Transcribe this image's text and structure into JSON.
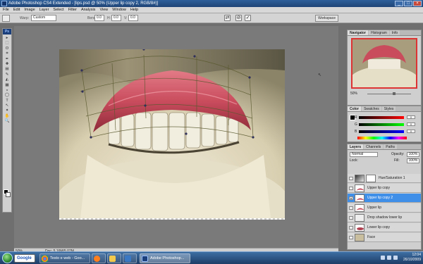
{
  "titlebar": {
    "title": "Adobe Photoshop CS4 Extended - [lips.psd @ 50% (Upper lip copy 2, RGB/8#)]",
    "min": "_",
    "max": "□",
    "close": "×"
  },
  "menu": [
    "File",
    "Edit",
    "Image",
    "Layer",
    "Select",
    "Filter",
    "Analysis",
    "View",
    "Window",
    "Help"
  ],
  "options": {
    "warp_label": "Warp:",
    "warp_value": "Custom",
    "bend_label": "Bend:",
    "bend_value": "0.0",
    "h_label": "H:",
    "h_value": "0.0",
    "v_label": "V:",
    "v_value": "0.0",
    "cancel_icon": "⊘",
    "commit_icon": "✓",
    "workspace": "Workspace"
  },
  "toolbox": {
    "logo": "Ps",
    "tools": [
      "▸",
      "⬚",
      "ʘ",
      "⌗",
      "✒",
      "✚",
      "▤",
      "✎",
      "◭",
      "▦",
      "◒",
      "◯",
      "T",
      "↖",
      "✦",
      "✋",
      "🔍"
    ]
  },
  "status": {
    "zoom": "50%",
    "doc": "Doc: 5.16M/5.07M"
  },
  "navigator": {
    "tabs": [
      "Navigator",
      "Histogram",
      "Info"
    ],
    "zoom": "50%"
  },
  "color": {
    "tabs": [
      "Color",
      "Swatches",
      "Styles"
    ],
    "r_label": "R",
    "g_label": "G",
    "b_label": "B",
    "r": "0",
    "g": "0",
    "b": "0"
  },
  "layers": {
    "tabs": [
      "Layers",
      "Channels",
      "Paths"
    ],
    "blend": "Normal",
    "opacity_label": "Opacity:",
    "opacity": "100%",
    "lock_label": "Lock:",
    "fill_label": "Fill:",
    "fill": "100%",
    "items": [
      {
        "name": "Hue/Saturation 1"
      },
      {
        "name": "Upper lip copy"
      },
      {
        "name": "Upper lip copy 2"
      },
      {
        "name": "Upper lip"
      },
      {
        "name": "Drop shadow lower lip"
      },
      {
        "name": "Lower lip copy"
      },
      {
        "name": "Face"
      }
    ]
  },
  "taskbar": {
    "search": "Google",
    "items": [
      {
        "label": "Testo e web - Goo..."
      },
      {
        "label": ""
      },
      {
        "label": ""
      },
      {
        "label": ""
      },
      {
        "label": "Adobe Photoshop..."
      }
    ],
    "time": "12:04",
    "date": "26/10/2009"
  }
}
